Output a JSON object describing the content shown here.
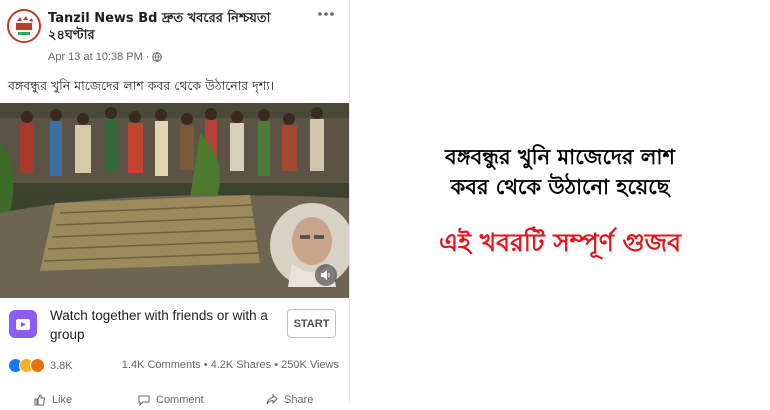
{
  "post": {
    "page_name": "Tanzil News Bd দ্রুত খবরের নিশ্চয়তা ২৪ঘণ্টার",
    "timestamp": "Apr 13 at 10:38 PM",
    "caption": "বঙ্গবন্ধুর খুনি মাজেদের লাশ কবর থেকে উঠানোর দৃশ্য।",
    "watch_prompt": "Watch together with friends or with a group",
    "start_label": "START",
    "reaction_count": "3.8K",
    "engagement": "1.4K Comments • 4.2K Shares • 250K Views",
    "actions": {
      "like": "Like",
      "comment": "Comment",
      "share": "Share"
    },
    "icons": [
      "page-avatar",
      "globe-icon",
      "more-icon",
      "volume-icon",
      "watch-party-icon",
      "like-reaction-icon",
      "sad-reaction-icon",
      "angry-reaction-icon",
      "like-icon",
      "comment-icon",
      "share-icon"
    ]
  },
  "fact_check": {
    "claim_line1": "বঙ্গবন্ধুর খুনি মাজেদের লাশ",
    "claim_line2": "কবর থেকে উঠানো হয়েছে",
    "verdict": "এই খবরটি সম্পূর্ণ গুজব",
    "verdict_color": "#e0161c"
  }
}
